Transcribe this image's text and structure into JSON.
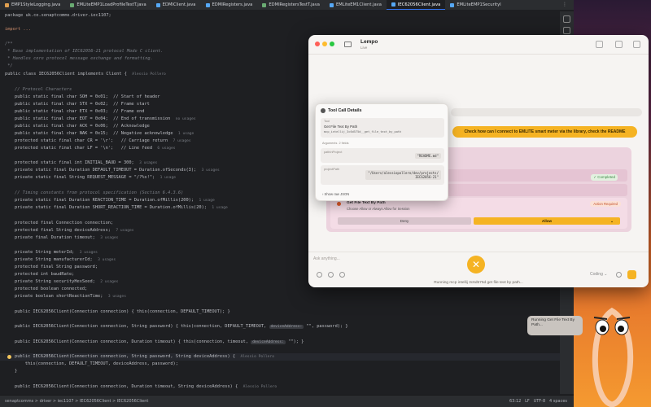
{
  "tabs": [
    {
      "label": "EMP1StyleLogging.java",
      "color": "#e0a050"
    },
    {
      "label": "EMLiteEMP1LoadProfileTestT.java",
      "color": "#6aab73"
    },
    {
      "label": "EDMIClient.java",
      "color": "#56a8f5"
    },
    {
      "label": "EDMIRegisters.java",
      "color": "#56a8f5"
    },
    {
      "label": "EDMIRegistersTestT.java",
      "color": "#6aab73"
    },
    {
      "label": "EMLiteEM1Client.java",
      "color": "#56a8f5"
    },
    {
      "label": "IEC62056Client.java",
      "color": "#56a8f5",
      "active": true
    },
    {
      "label": "EMLiteEMP1SecurityI",
      "color": "#56a8f5"
    }
  ],
  "code": {
    "package_line": "package uk.co.senaptcomms.driver.iec1107;",
    "import_line": "import ...",
    "doc_open": "/**",
    "doc_1": " * Base implementation of IEC62056-21 protocol Mode C client.",
    "doc_2": " * Handles core protocol message exchange and formatting.",
    "doc_close": " */",
    "class_decl": "public class IEC62056Client implements Client {",
    "class_author": "Alessio Pollero",
    "protocol_chars": "// Protocol Characters",
    "c_soh": "public static final char SOH = 0x01;  // Start of header",
    "c_stx": "public static final char STX = 0x02;  // Frame start",
    "c_etx": "public static final char ETX = 0x03;  // Frame end",
    "c_eot": "public static final char EOT = 0x04;  // End of transmission",
    "c_eot_hint": "no usages",
    "c_ack": "public static final char ACK = 0x06;  // Acknowledge",
    "c_nak": "public static final char NAK = 0x15;  // Negative acknowledge",
    "c_nak_hint": "1 usage",
    "c_cr": "protected static final char CR = '\\r';   // Carriage return",
    "c_cr_hint": "7 usages",
    "c_lf": "protected static final char LF = '\\n';   // Line feed",
    "c_lf_hint": "6 usages",
    "c_baud": "protected static final int INITIAL_BAUD = 300;",
    "c_baud_hint": "3 usages",
    "c_timeout": "private static final Duration DEFAULT_TIMEOUT = Duration.ofSeconds(3);",
    "c_timeout_hint": "3 usages",
    "c_req": "private static final String REQUEST_MESSAGE = \"/?%s!\";",
    "c_req_hint": "1 usage",
    "timing_cm": "// Timing constants from protocol specification (Section 6.4.3.6)",
    "c_react": "private static final Duration REACTION_TIME = Duration.ofMillis(200);",
    "c_react_hint": "1 usage",
    "c_short": "private static final Duration SHORT_REACTION_TIME = Duration.ofMillis(20);",
    "c_short_hint": "1 usage",
    "f_conn": "protected final Connection connection;",
    "f_addr": "protected final String deviceAddress;",
    "f_addr_hint": "7 usages",
    "f_timeout": "private final Duration timeout;",
    "f_timeout_hint": "3 usages",
    "f_meter": "private String meterId;",
    "f_meter_hint": "3 usages",
    "f_manu": "private String manufacturerId;",
    "f_manu_hint": "3 usages",
    "f_pass": "protected final String password;",
    "f_baud": "protected int baudRate;",
    "f_sec": "private String securityHexSeed;",
    "f_sec_hint": "2 usages",
    "f_connd": "protected boolean connected;",
    "f_short": "private boolean shortReactionTime;",
    "f_short_hint": "3 usages",
    "ctor1": "public IEC62056Client(Connection connection) { this(connection, DEFAULT_TIMEOUT); }",
    "ctor2": "public IEC62056Client(Connection connection, String password) { this(connection, DEFAULT_TIMEOUT,",
    "ctor2_inlay": "deviceAddress:",
    "ctor2_tail": "\"\", password); }",
    "ctor3": "public IEC62056Client(Connection connection, Duration timeout) { this(connection, timeout,",
    "ctor3_inlay": "deviceAddress:",
    "ctor3_tail": "\"\"); }",
    "ctor4": "public IEC62056Client(Connection connection, String password, String deviceAddress) {",
    "ctor4_author": "Alessio Pollero",
    "ctor4_body": "    this(connection, DEFAULT_TIMEOUT, deviceAddress, password);",
    "ctor4_close": "}",
    "ctor5": "public IEC62056Client(Connection connection, Duration timeout, String deviceAddress) {",
    "ctor5_author": "Alessio Pollero"
  },
  "statusbar": {
    "breadcrumbs": "senaptcomms  >  driver  >  iec1107  >  IEC62056Client  >  IEC62056Client",
    "position": "63:12",
    "line_sep": "LF",
    "encoding": "UTF-8",
    "indent": "4 spaces"
  },
  "lempo": {
    "app_name": "Lempo",
    "status": "Live",
    "user_message": "Check how can I connect to EMLITE smart meter via the library, check the README",
    "approval": {
      "completed_label": "✓ Completed",
      "pending_title": "Get File Text By Path",
      "pending_desc": "Choose Allow or Always Allow for Session",
      "action_badge": "Action Required",
      "deny_label": "Deny",
      "allow_label": "Allow",
      "allow_chevron": "⌄"
    },
    "composer": {
      "placeholder": "Ask anything...",
      "mode": "Coding ⌄",
      "running_text": "Running mcp intellij 3c6d575d  get file text by path..."
    }
  },
  "tool_popup": {
    "title": "Tool Call Details",
    "tool_label": "Tool",
    "tool_name": "Get File Text By Path",
    "tool_id": "mcp_intellij_3c6d575d__get_file_text_by_path",
    "args_label": "Arguments",
    "args_count": "2 fields",
    "arg1_key": "pathInProject",
    "arg1_val": "\"README.md\"",
    "arg2_key": "projectPath",
    "arg2_val_1": "\"/Users/alessiopollero/dev/projects/",
    "arg2_val_2": "IEC62056-21\"",
    "show_raw": "› Show raw JSON"
  },
  "mascot": {
    "bubble_text": "Running Get File Text By Path..."
  },
  "colors": {
    "accent": "#f5b323",
    "ide_bg": "#1e1f22"
  }
}
